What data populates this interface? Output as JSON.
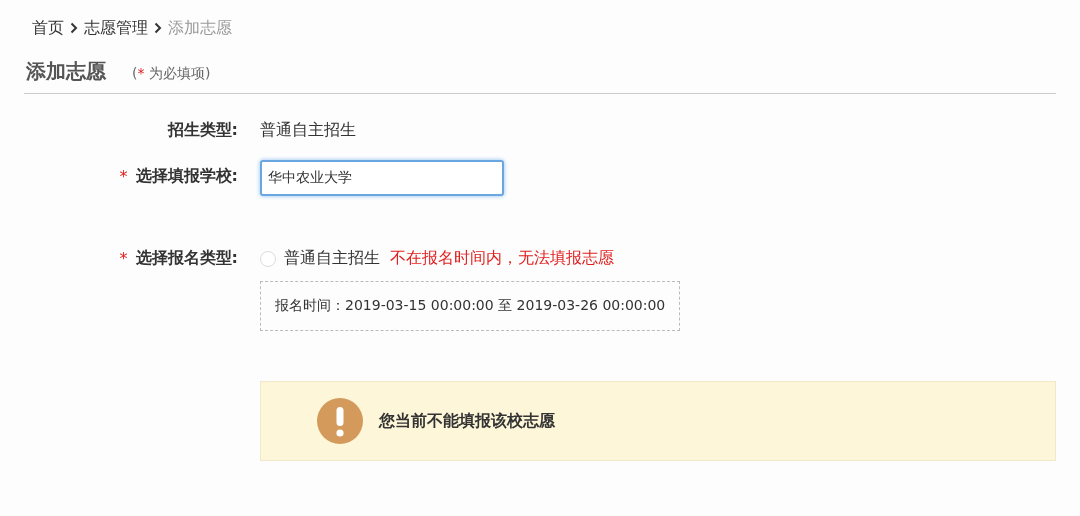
{
  "breadcrumb": [
    {
      "label": "首页",
      "current": false
    },
    {
      "label": "志愿管理",
      "current": false
    },
    {
      "label": "添加志愿",
      "current": true
    }
  ],
  "heading": {
    "title": "添加志愿",
    "note_open": "(",
    "note_mark": "*",
    "note_text": " 为必填项)"
  },
  "form": [
    {
      "kind": "text",
      "label": "招生类型:",
      "value": "普通自主招生"
    },
    {
      "kind": "input",
      "mark": "*",
      "label": "选择填报学校:",
      "value": "华中农业大学"
    },
    {
      "kind": "radio",
      "mark": "*",
      "label": "选择报名类型:",
      "option": "普通自主招生",
      "selected": false,
      "error": "不在报名时间内，无法填报志愿",
      "period": "报名时间：2019-03-15 00:00:00 至 2019-03-26 00:00:00"
    }
  ],
  "notice": {
    "text": "您当前不能填报该校志愿"
  }
}
